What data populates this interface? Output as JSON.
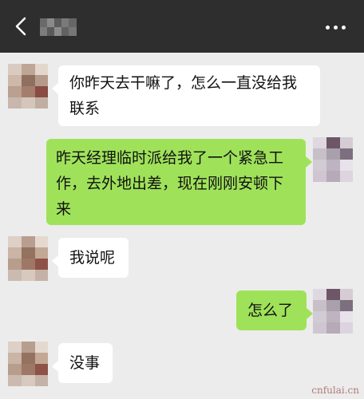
{
  "header": {
    "back_icon": "chevron-left-icon",
    "more_icon": "more-horizontal-icon",
    "background": "#2e2e2e"
  },
  "colors": {
    "incoming_bubble": "#ffffff",
    "outgoing_bubble": "#9fe25a",
    "chat_background": "#ececec"
  },
  "messages": [
    {
      "side": "left",
      "lines": [
        "你昨天去干嘛了，怎么一直没给我",
        "联系"
      ]
    },
    {
      "side": "right",
      "lines": [
        "昨天经理临时派给我了一个紧急工",
        "作，去外地出差，现在刚刚安顿下",
        "来"
      ]
    },
    {
      "side": "left",
      "lines": [
        "我说呢"
      ]
    },
    {
      "side": "right",
      "lines": [
        "怎么了"
      ]
    },
    {
      "side": "left",
      "lines": [
        "没事"
      ]
    }
  ],
  "watermark": "cnfulai.cn"
}
